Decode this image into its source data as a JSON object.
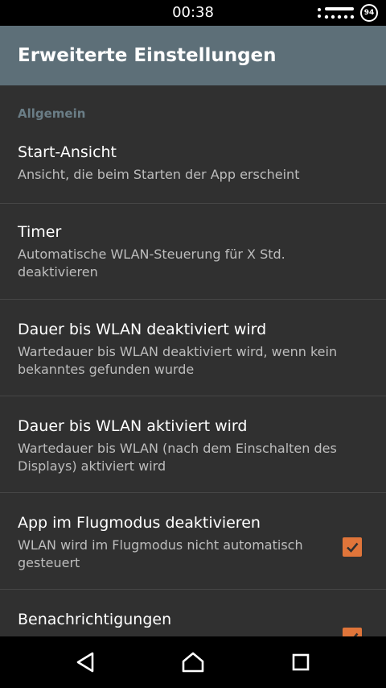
{
  "status_bar": {
    "time": "00:38",
    "battery": "94"
  },
  "app_bar": {
    "title": "Erweiterte Einstellungen"
  },
  "section": {
    "header": "Allgemein"
  },
  "prefs": [
    {
      "title": "Start-Ansicht",
      "summary": "Ansicht, die beim Starten der App erscheint"
    },
    {
      "title": "Timer",
      "summary": "Automatische WLAN-Steuerung für X Std. deaktivieren"
    },
    {
      "title": "Dauer bis WLAN deaktiviert wird",
      "summary": "Wartedauer bis WLAN deaktiviert wird, wenn kein bekanntes gefunden wurde"
    },
    {
      "title": "Dauer bis WLAN aktiviert wird",
      "summary": "Wartedauer bis WLAN (nach dem Einschalten des Displays) aktiviert wird"
    },
    {
      "title": "App im Flugmodus deaktivieren",
      "summary": "WLAN wird im Flugmodus nicht automatisch gesteuert",
      "checked": true
    },
    {
      "title": "Benachrichtigungen",
      "summary": "",
      "checked": true
    }
  ],
  "colors": {
    "accent": "#e0753a",
    "app_bar": "#5d6f78",
    "background": "#303030",
    "section_header": "#6a7d86"
  },
  "icons": {
    "back": "back-triangle-icon",
    "home": "home-icon",
    "recents": "recents-square-icon",
    "check": "check-icon"
  }
}
